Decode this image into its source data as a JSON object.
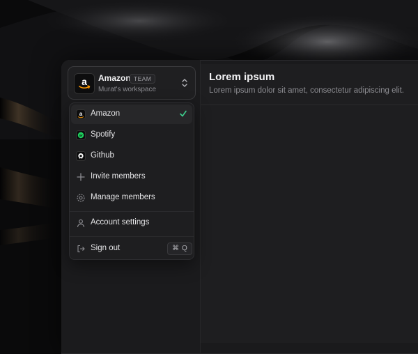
{
  "workspace_switcher": {
    "name": "Amazon",
    "badge": "TEAM",
    "subtitle": "Murat's workspace",
    "logo_letter": "a"
  },
  "main": {
    "title": "Lorem ipsum",
    "subtitle": "Lorem ipsum dolor sit amet, consectetur adipiscing elit."
  },
  "menu": {
    "workspaces": [
      {
        "label": "Amazon",
        "icon": "amazon-icon",
        "selected": true
      },
      {
        "label": "Spotify",
        "icon": "spotify-icon",
        "selected": false
      },
      {
        "label": "Github",
        "icon": "github-icon",
        "selected": false
      }
    ],
    "actions": [
      {
        "label": "Invite members",
        "icon": "plus-icon"
      },
      {
        "label": "Manage members",
        "icon": "settings-icon"
      }
    ],
    "account": {
      "label": "Account settings",
      "icon": "user-icon"
    },
    "sign_out": {
      "label": "Sign out",
      "icon": "sign-out-icon",
      "shortcut_symbol": "⌘",
      "shortcut_key": "Q"
    }
  },
  "colors": {
    "check": "#3ecf8e",
    "spotify": "#1ed760",
    "amazon_arrow": "#ff9900"
  }
}
